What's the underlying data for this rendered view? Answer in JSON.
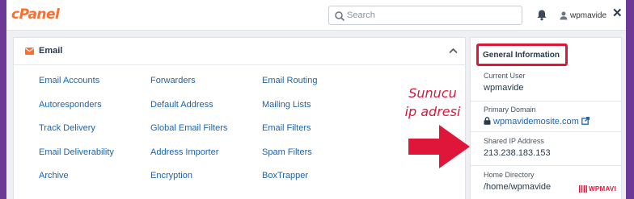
{
  "header": {
    "logo_text": "cPanel",
    "search_placeholder": "Search",
    "username": "wpmavide",
    "close_glyph": "✕"
  },
  "email_section": {
    "title": "Email",
    "icon": "envelope-icon",
    "links": [
      "Email Accounts",
      "Forwarders",
      "Email Routing",
      "Autoresponders",
      "Default Address",
      "Mailing Lists",
      "Track Delivery",
      "Global Email Filters",
      "Email Filters",
      "Email Deliverability",
      "Address Importer",
      "Spam Filters",
      "Archive",
      "Encryption",
      "BoxTrapper"
    ]
  },
  "general_info": {
    "title": "General Information",
    "current_user_label": "Current User",
    "current_user_value": "wpmavide",
    "primary_domain_label": "Primary Domain",
    "primary_domain_value": "wpmavidemosite.com",
    "shared_ip_label": "Shared IP Address",
    "shared_ip_value": "213.238.183.153",
    "home_dir_label": "Home Directory",
    "home_dir_value": "/home/wpmavide"
  },
  "annotation": {
    "line1": "Sunucu",
    "line2": "ip adresi",
    "color": "#e0153a"
  },
  "watermark": "WPMAVI",
  "colors": {
    "accent": "#ff6c2c",
    "link": "#1c63b0",
    "highlight": "#e0153a",
    "background": "#6c3a96"
  }
}
